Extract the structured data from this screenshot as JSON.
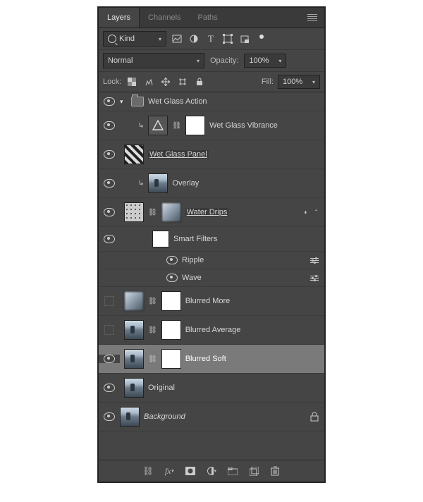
{
  "tabs": {
    "layers": "Layers",
    "channels": "Channels",
    "paths": "Paths"
  },
  "filter": {
    "label": "Kind"
  },
  "blend": {
    "mode": "Normal",
    "opacity_label": "Opacity:",
    "opacity_value": "100%"
  },
  "lock": {
    "label": "Lock:",
    "fill_label": "Fill:",
    "fill_value": "100%"
  },
  "group": {
    "name": "Wet Glass Action"
  },
  "layers": {
    "vibrance": "Wet Glass Vibrance",
    "panel": "Wet Glass Panel",
    "overlay": "Overlay",
    "water_drips": "Water Drips",
    "smart_filters": "Smart Filters",
    "ripple": "Ripple",
    "wave": "Wave",
    "blurred_more": "Blurred More",
    "blurred_average": "Blurred Average",
    "blurred_soft": "Blurred Soft",
    "original": "Original",
    "background": "Background"
  }
}
